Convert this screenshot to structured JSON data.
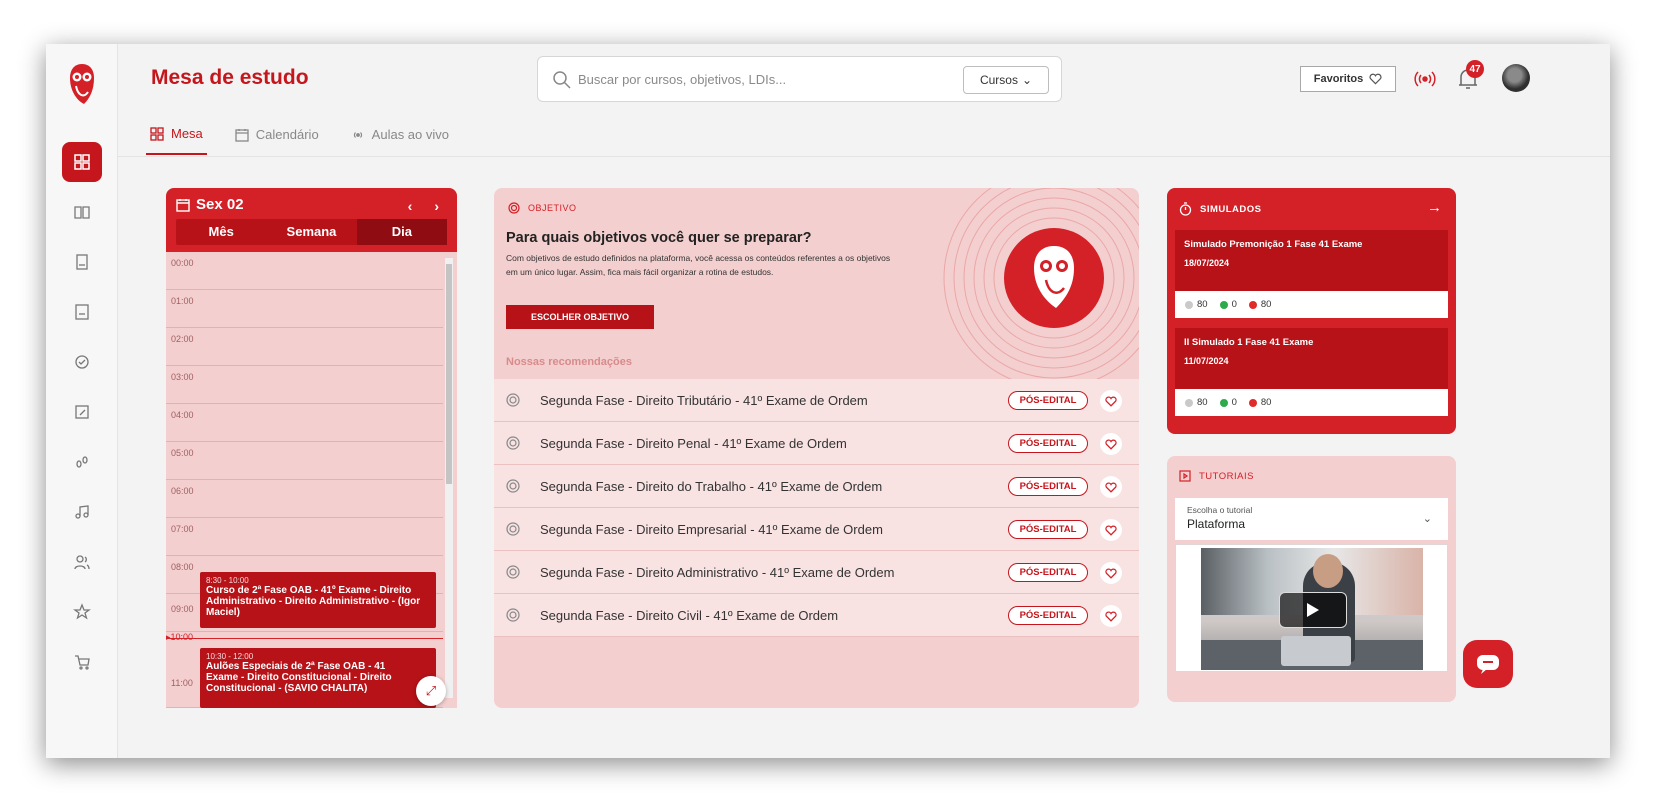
{
  "header": {
    "title": "Mesa de estudo",
    "search_placeholder": "Buscar por cursos, objetivos, LDIs...",
    "search_scope": "Cursos",
    "favorites_label": "Favoritos",
    "notification_count": "47"
  },
  "tabs": [
    {
      "label": "Mesa",
      "active": true
    },
    {
      "label": "Calendário",
      "active": false
    },
    {
      "label": "Aulas ao vivo",
      "active": false
    }
  ],
  "calendar": {
    "date_label": "Sex 02",
    "views": [
      "Mês",
      "Semana",
      "Dia"
    ],
    "active_view": "Dia",
    "hours": [
      "00:00",
      "01:00",
      "02:00",
      "03:00",
      "04:00",
      "05:00",
      "06:00",
      "07:00",
      "08:00",
      "09:00",
      "10:00",
      "11:00"
    ],
    "now_label": "10:00",
    "events": [
      {
        "time": "8:30 - 10:00",
        "title": "Curso de 2ª Fase OAB - 41º Exame - Direito Administrativo - Direito Administrativo - (Igor Maciel)"
      },
      {
        "time": "10:30 - 12:00",
        "title": "Aulões Especiais de 2ª Fase OAB - 41 Exame - Direito Constitucional - Direito Constitucional - (SAVIO CHALITA)"
      }
    ]
  },
  "objetivo": {
    "section_label": "OBJETIVO",
    "title": "Para quais objetivos você quer se preparar?",
    "description": "Com objetivos de estudo definidos na plataforma, você acessa os conteúdos referentes a os objetivos em um único lugar. Assim, fica mais fácil organizar a rotina de estudos.",
    "button_label": "ESCOLHER OBJETIVO",
    "recommendations_title": "Nossas recomendações",
    "badge_label": "PÓS-EDITAL",
    "recommendations": [
      "Segunda Fase - Direito Tributário - 41º Exame de Ordem",
      "Segunda Fase - Direito Penal - 41º Exame de Ordem",
      "Segunda Fase - Direito do Trabalho - 41º Exame de Ordem",
      "Segunda Fase - Direito Empresarial - 41º Exame de Ordem",
      "Segunda Fase - Direito Administrativo - 41º Exame de Ordem",
      "Segunda Fase - Direito Civil - 41º Exame de Ordem"
    ]
  },
  "simulados": {
    "title": "SIMULADOS",
    "items": [
      {
        "name": "Simulado Premonição 1 Fase 41 Exame",
        "date": "18/07/2024",
        "total": "80",
        "correct": "0",
        "wrong": "80"
      },
      {
        "name": "II Simulado 1 Fase 41 Exame",
        "date": "11/07/2024",
        "total": "80",
        "correct": "0",
        "wrong": "80"
      }
    ]
  },
  "tutoriais": {
    "title": "TUTORIAIS",
    "select_label": "Escolha o tutorial",
    "select_value": "Plataforma"
  },
  "colors": {
    "brand": "#d42027",
    "brand_dark": "#b71218",
    "card_bg": "#f4cfcf"
  }
}
